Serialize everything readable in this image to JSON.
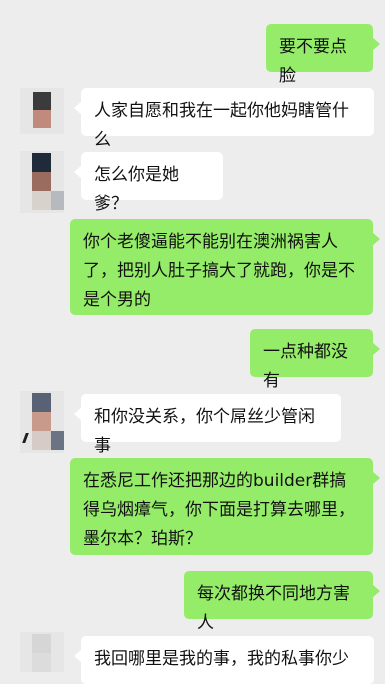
{
  "conversation": {
    "messages": [
      {
        "side": "right",
        "text": "要不要点脸"
      },
      {
        "side": "left",
        "text": "人家自愿和我在一起你他妈瞎管什么"
      },
      {
        "side": "left",
        "text": "怎么你是她爹？"
      },
      {
        "side": "right",
        "text": "你个老傻逼能不能别在澳洲祸害人了，把别人肚子搞大了就跑，你是不是个男的"
      },
      {
        "side": "right",
        "text": "一点种都没有"
      },
      {
        "side": "left",
        "text": "和你没关系，你个屌丝少管闲事"
      },
      {
        "side": "right",
        "text": "在悉尼工作还把那边的builder群搞得乌烟瘴气，你下面是打算去哪里，墨尔本？珀斯？"
      },
      {
        "side": "right",
        "text": "每次都换不同地方害人"
      },
      {
        "side": "left",
        "text": "我回哪里是我的事，我的私事你少"
      }
    ]
  },
  "colors": {
    "background": "#ededed",
    "bubble_sent": "#95ec69",
    "bubble_received": "#ffffff"
  }
}
